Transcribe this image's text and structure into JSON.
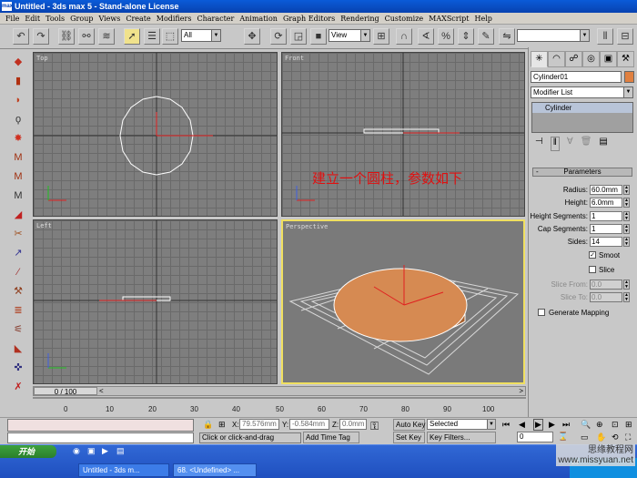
{
  "window": {
    "title": "Untitled - 3ds max 5 - Stand-alone License",
    "app_icon": "max"
  },
  "menu": [
    "File",
    "Edit",
    "Tools",
    "Group",
    "Views",
    "Create",
    "Modifiers",
    "Character",
    "Animation",
    "Graph Editors",
    "Rendering",
    "Customize",
    "MAXScript",
    "Help"
  ],
  "toolbar": {
    "selection_filter": "All",
    "ref_coord": "View",
    "named_sel": ""
  },
  "viewports": {
    "top": "Top",
    "front": "Front",
    "left": "Left",
    "perspective": "Perspective"
  },
  "annotation": "建立一个圆柱，参数如下",
  "time_slider": {
    "label": "0 / 100",
    "start": "<",
    "end": ">",
    "current": 0,
    "total": 100
  },
  "ruler_ticks": [
    "0",
    "10",
    "20",
    "30",
    "40",
    "50",
    "60",
    "70",
    "80",
    "90",
    "100"
  ],
  "command_panel": {
    "object_name": "Cylinder01",
    "object_color": "#e08040",
    "modifier_list": "Modifier List",
    "stack_item": "Cylinder",
    "rollout_title": "Parameters",
    "params": [
      {
        "label": "Radius:",
        "value": "60.0mm"
      },
      {
        "label": "Height:",
        "value": "6.0mm"
      },
      {
        "label": "Height Segments:",
        "value": "1"
      },
      {
        "label": "Cap Segments:",
        "value": "1"
      },
      {
        "label": "Sides:",
        "value": "14"
      }
    ],
    "smooth": {
      "label": "Smoot",
      "checked": true
    },
    "slice": {
      "label": "Slice",
      "checked": false
    },
    "slice_from": {
      "label": "Slice From:",
      "value": "0.0"
    },
    "slice_to": {
      "label": "Slice To:",
      "value": "0.0"
    },
    "gen_mapping": {
      "label": "Generate Mapping",
      "checked": false
    }
  },
  "status": {
    "prompt": "Click or click-and-drag",
    "add_time_tag": "Add Time Tag",
    "x_label": "X:",
    "x_value": "79.576mm",
    "y_label": "Y:",
    "y_value": "-0.584mm",
    "z_label": "Z:",
    "z_value": "0.0mm",
    "auto_key": "Auto Key",
    "set_key": "Set Key",
    "key_mode": "Selected",
    "key_filters": "Key Filters...",
    "frame": "0"
  },
  "taskbar": {
    "start": "开始",
    "tasks": [
      "Untitled - 3ds m...",
      "68. <Undefined> ..."
    ],
    "clock": "24"
  },
  "watermark": {
    "line1": "思缘教程网",
    "line2": "www.missyuan.net"
  }
}
